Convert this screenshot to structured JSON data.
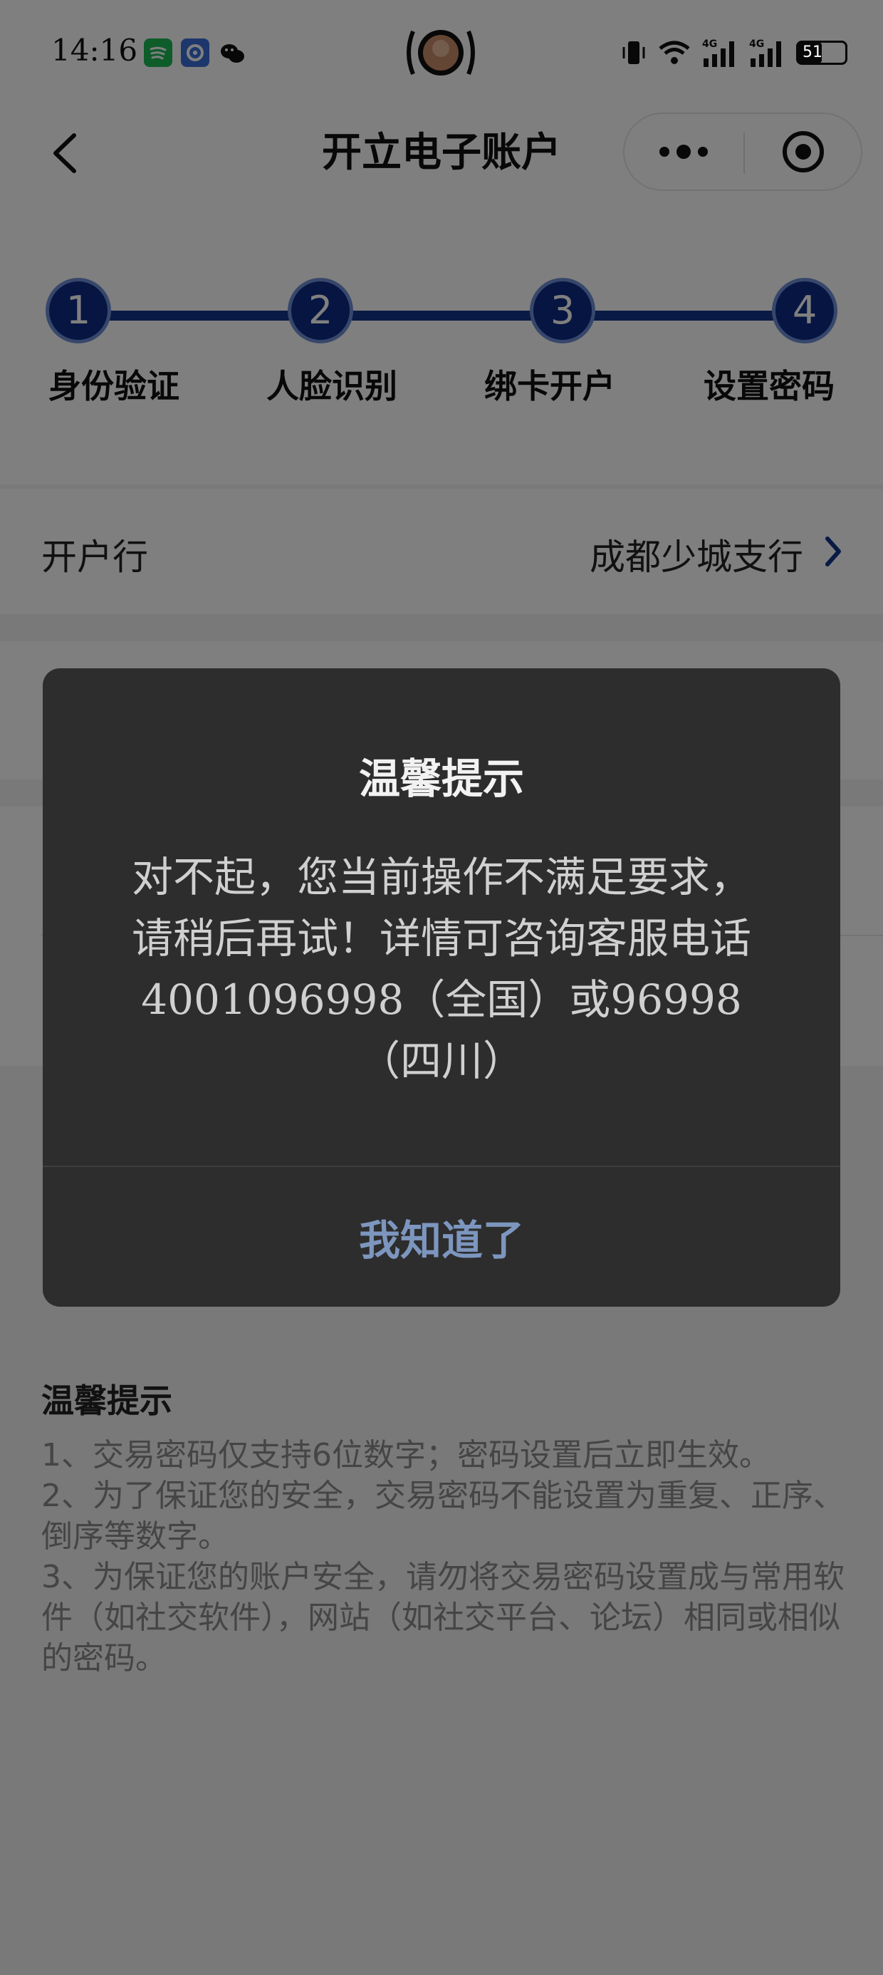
{
  "status_bar": {
    "time": "14:16",
    "battery": "51",
    "icons": [
      "spotify-icon",
      "browser-icon",
      "wechat-icon",
      "camera-avatar",
      "vibrate-icon",
      "wifi-icon",
      "signal-4g-icon",
      "signal-4g-icon",
      "battery-icon"
    ]
  },
  "nav": {
    "title": "开立电子账户"
  },
  "stepper": {
    "steps": [
      {
        "num": "1",
        "label": "身份验证"
      },
      {
        "num": "2",
        "label": "人脸识别"
      },
      {
        "num": "3",
        "label": "绑卡开户"
      },
      {
        "num": "4",
        "label": "设置密码"
      }
    ],
    "active_color": "#0d2a82"
  },
  "form": {
    "bank_label": "开户行",
    "bank_value": "成都少城支行"
  },
  "tips": {
    "title": "温馨提示",
    "items": [
      "1、交易密码仅支持6位数字；密码设置后立即生效。",
      "2、为了保证您的安全，交易密码不能设置为重复、正序、倒序等数字。",
      "3、为保证您的账户安全，请勿将交易密码设置成与常用软件（如社交软件），网站（如社交平台、论坛）相同或相似的密码。"
    ]
  },
  "modal": {
    "title": "温馨提示",
    "message": "对不起，您当前操作不满足要求，请稍后再试！详情可咨询客服电话4001096998（全国）或96998（四川）",
    "button": "我知道了"
  },
  "colors": {
    "overlay": "rgba(0,0,0,0.5)",
    "modal_bg": "#2d2d2d",
    "modal_button": "#7d96bf",
    "accent": "#13378a"
  }
}
